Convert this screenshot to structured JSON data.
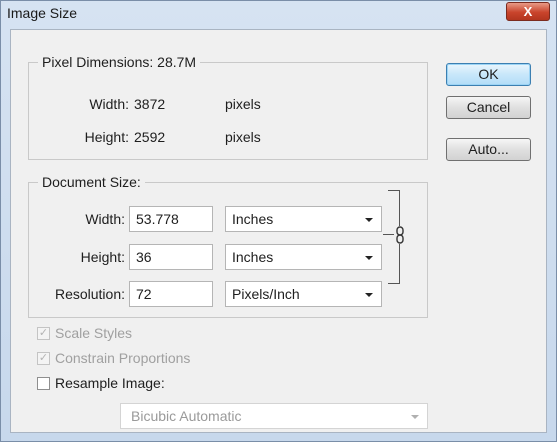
{
  "window": {
    "title": "Image Size",
    "close_glyph": "X"
  },
  "pixel_dimensions": {
    "legend": "Pixel Dimensions:",
    "size": "28.7M",
    "width_label": "Width:",
    "width_value": "3872",
    "width_unit": "pixels",
    "height_label": "Height:",
    "height_value": "2592",
    "height_unit": "pixels"
  },
  "document_size": {
    "legend": "Document Size:",
    "width_label": "Width:",
    "width_value": "53.778",
    "width_unit": "Inches",
    "height_label": "Height:",
    "height_value": "36",
    "height_unit": "Inches",
    "resolution_label": "Resolution:",
    "resolution_value": "72",
    "resolution_unit": "Pixels/Inch"
  },
  "buttons": {
    "ok": "OK",
    "cancel": "Cancel",
    "auto": "Auto..."
  },
  "options": {
    "scale_styles": {
      "label": "Scale Styles",
      "checked": true,
      "enabled": false
    },
    "constrain_proportions": {
      "label": "Constrain Proportions",
      "checked": true,
      "enabled": false
    },
    "resample_image": {
      "label": "Resample Image:",
      "checked": false,
      "enabled": true
    },
    "resample_method": {
      "value": "Bicubic Automatic",
      "enabled": false
    }
  },
  "icons": {
    "link": "chain-link-icon",
    "check": "checkmark-icon"
  }
}
